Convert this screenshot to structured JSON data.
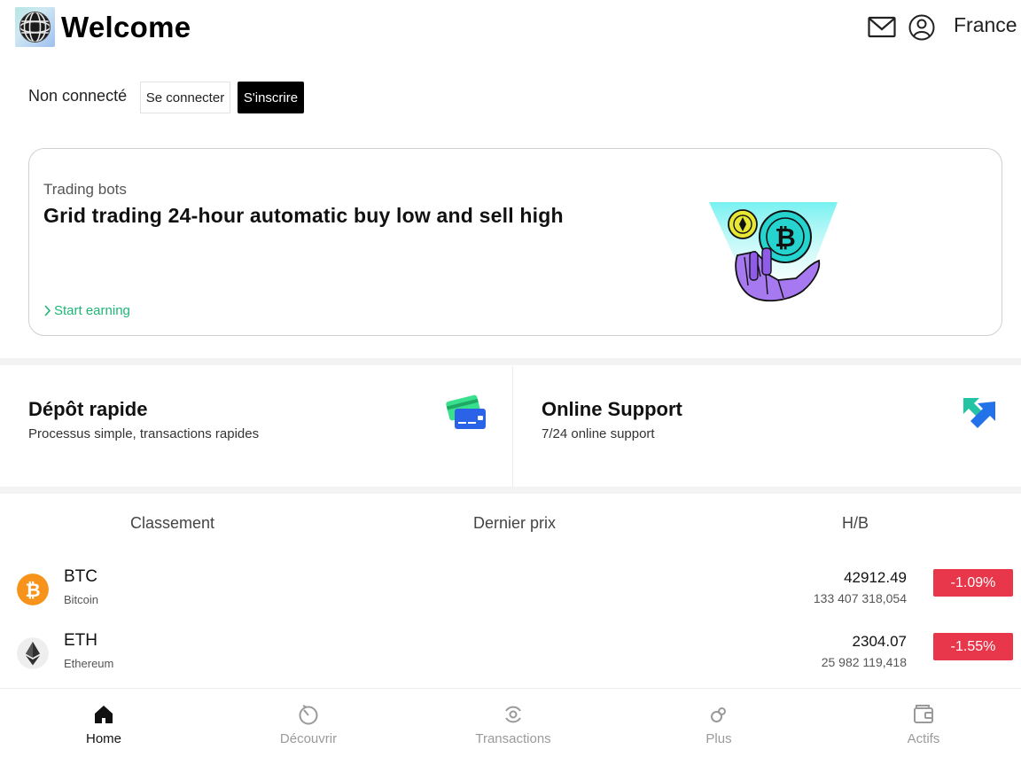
{
  "header": {
    "title": "Welcome",
    "logo_icon": "globe-sphere-logo",
    "mail_icon": "mail-icon",
    "account_icon": "user-circle-icon",
    "country": "France"
  },
  "auth": {
    "status": "Non connecté",
    "login_label": "Se connecter",
    "signup_label": "S'inscrire"
  },
  "banner": {
    "subtitle": "Trading bots",
    "title": "Grid trading 24-hour automatic buy low and sell high",
    "link_label": "Start earning",
    "link_color": "#20b577",
    "art": "robot-hand-coins-illustration"
  },
  "cards": [
    {
      "title": "Dépôt rapide",
      "description": "Processus simple, transactions rapides",
      "icon": "credit-cards-icon"
    },
    {
      "title": "Online Support",
      "description": "7/24 online support",
      "icon": "support-arrows-icon"
    }
  ],
  "market": {
    "headers": [
      "Classement",
      "Dernier prix",
      "H/B"
    ],
    "rows": [
      {
        "symbol": "BTC",
        "name": "Bitcoin",
        "price": "42912.49",
        "volume": "133 407 318,054",
        "change": "-1.09%",
        "icon": "bitcoin-icon"
      },
      {
        "symbol": "ETH",
        "name": "Ethereum",
        "price": "2304.07",
        "volume": "25 982 119,418",
        "change": "-1.55%",
        "icon": "ethereum-icon"
      }
    ],
    "negative_color": "#e8374a"
  },
  "nav": {
    "items": [
      {
        "label": "Home",
        "icon": "home-icon",
        "active": true
      },
      {
        "label": "Découvrir",
        "icon": "discover-icon",
        "active": false
      },
      {
        "label": "Transactions",
        "icon": "transactions-icon",
        "active": false
      },
      {
        "label": "Plus",
        "icon": "more-icon",
        "active": false
      },
      {
        "label": "Actifs",
        "icon": "wallet-icon",
        "active": false
      }
    ]
  }
}
